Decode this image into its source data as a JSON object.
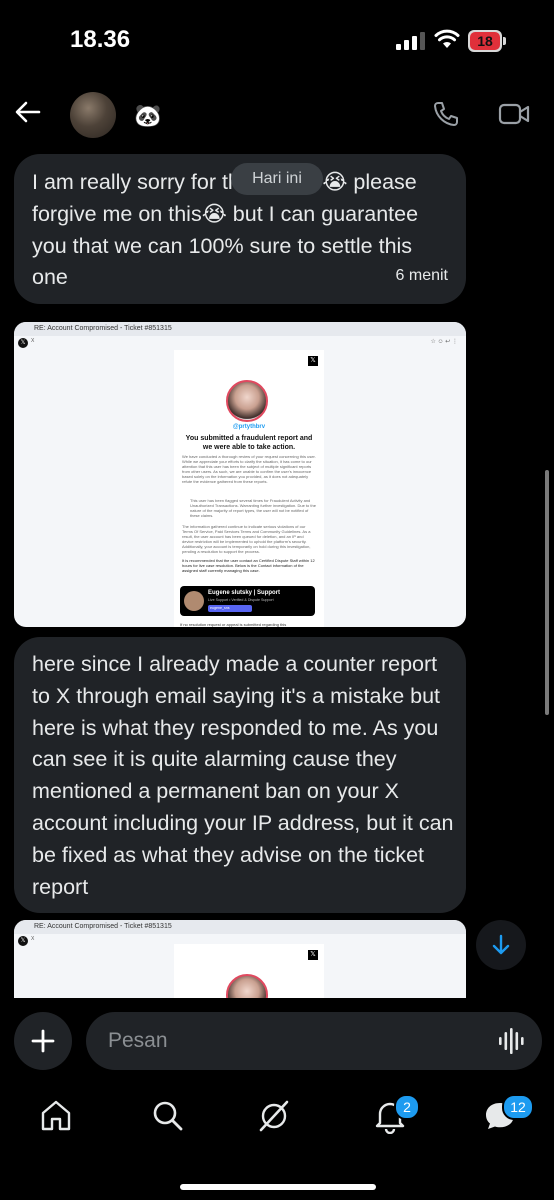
{
  "status_bar": {
    "time": "18.36",
    "battery": "18"
  },
  "header": {
    "contact_emoji": "🐼"
  },
  "date_pill": "Hari ini",
  "messages": [
    {
      "text": "I am really sorry  for this matter😭 please forgive me on this😭 but I can guarantee you that we can 100% sure to settle this one",
      "time": "6 menit"
    },
    {
      "text": "here since I already made a counter report to X through email saying it's a mistake but here is what they responded to me. As you can see it is quite alarming cause they mentioned a permanent ban on your X account including your IP address, but it can be fixed as what they advise on the ticket report"
    }
  ],
  "email_screenshot": {
    "subject": "RE: Account Compromised - Ticket #851315",
    "sender": "X",
    "handle": "@prtythbrv",
    "headline": "You submitted a fraudulent report and we were able to take action.",
    "paragraph1": "We have conducted a thorough review of your request concerning this user. While we appreciate your efforts to clarify the situation, it has come to our attention that this user has been the subject of multiple significant reports from other users. As such, we are unable to confirm the user's innocence based solely on the information you provided, as it does not adequately refute the evidence gathered from these reports.",
    "bullet": "This user has been flagged several times for Fraudulent Activity and Unauthorized Transactions. Warranting further investigation. Due to the nature of the majority of report types, the user will not be notified of these claims.",
    "paragraph2": "The information gathered continue to indicate serious violations of our Terms Of Service, Paid Services Terms and Community Guidelines. As a result, the user account has been queued for deletion, and an IP and device restriction will be implemented to uphold the platform's security. Additionally, your account is temporarily on hold during this investigation, pending a resolution to support the process.",
    "paragraph3": "It is recommended that the user contact an Certified Dispute Staff within 12 hours for live case resolution. Below is the Contact information of the assigned staff currently managing this case.",
    "support_name": "Eugene slutsky | Support",
    "support_role": "Live Support • Verified & Dispute Support",
    "support_discord": "eugene_sns",
    "warning": "If no resolution request or appeal is submitted regarding this"
  },
  "composer": {
    "placeholder": "Pesan"
  },
  "nav": {
    "notifications_badge": "2",
    "messages_badge": "12"
  },
  "colors": {
    "accent": "#1d9bf0",
    "bubble": "#202327",
    "background": "#000000"
  }
}
